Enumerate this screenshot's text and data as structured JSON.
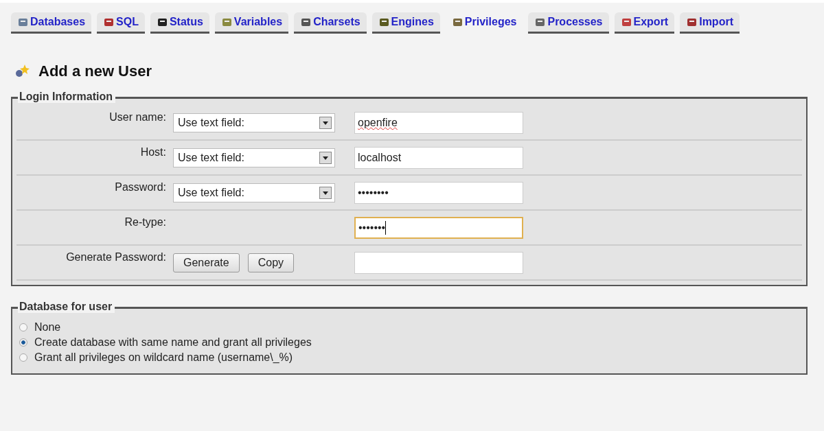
{
  "tabs": [
    {
      "label": "Databases",
      "selected": false
    },
    {
      "label": "SQL",
      "selected": false
    },
    {
      "label": "Status",
      "selected": false
    },
    {
      "label": "Variables",
      "selected": false
    },
    {
      "label": "Charsets",
      "selected": false
    },
    {
      "label": "Engines",
      "selected": false
    },
    {
      "label": "Privileges",
      "selected": true
    },
    {
      "label": "Processes",
      "selected": false
    },
    {
      "label": "Export",
      "selected": false
    },
    {
      "label": "Import",
      "selected": false
    }
  ],
  "heading": "Add a new User",
  "login": {
    "legend": "Login Information",
    "rows": [
      {
        "kind": "select",
        "label": "User name:",
        "select": "Use text field:",
        "value": "openfire",
        "focused": false
      },
      {
        "kind": "select",
        "label": "Host:",
        "select": "Use text field:",
        "value": "localhost",
        "focused": false
      },
      {
        "kind": "select",
        "label": "Password:",
        "select": "Use text field:",
        "value": "••••••••",
        "focused": false
      },
      {
        "kind": "plain",
        "label": "Re-type:",
        "value": "•••••••",
        "focused": true
      },
      {
        "kind": "buttons",
        "label": "Generate Password:",
        "buttons": [
          "Generate",
          "Copy"
        ],
        "focused": false
      }
    ]
  },
  "database": {
    "legend": "Database for user",
    "options": [
      {
        "label": "None",
        "selected": false
      },
      {
        "label": "Create database with same name and grant all privileges",
        "selected": true
      },
      {
        "label": "Grant all privileges on wildcard name (username\\_%)",
        "selected": false
      }
    ]
  }
}
